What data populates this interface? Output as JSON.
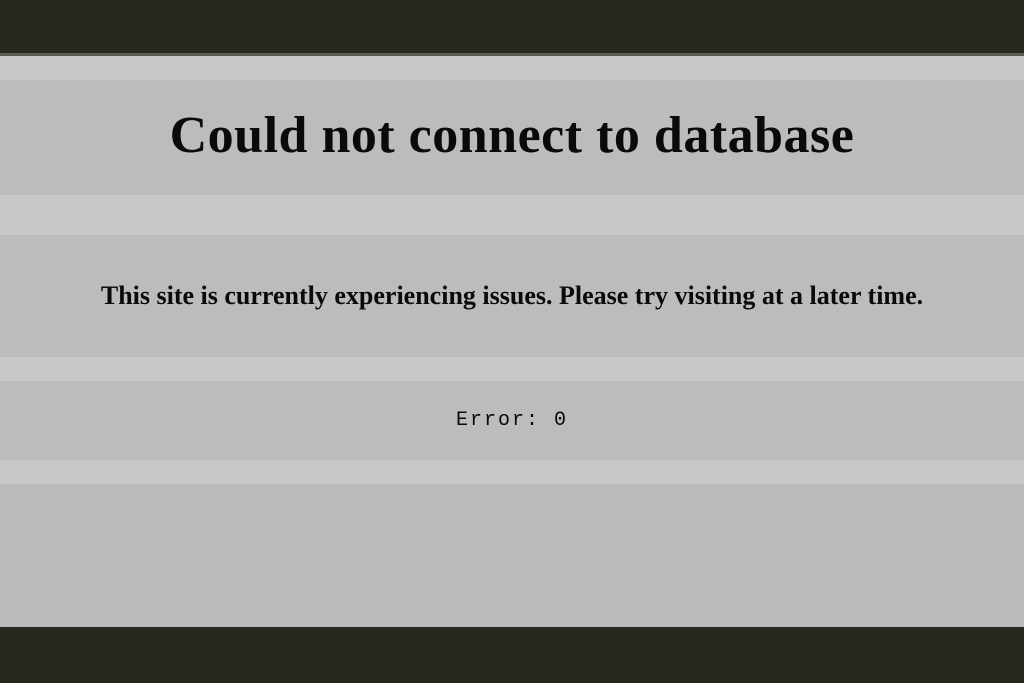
{
  "error": {
    "title": "Could not connect to database",
    "subtitle": "This site is currently experiencing issues. Please try visiting at a later time.",
    "code_label": "Error:",
    "code_value": "0"
  }
}
